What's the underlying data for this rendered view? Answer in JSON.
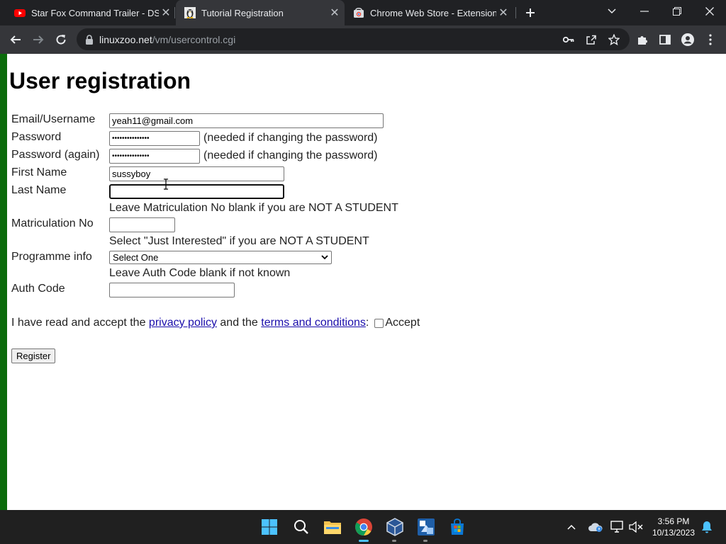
{
  "browser": {
    "tabs": [
      {
        "title": "Star Fox Command Trailer - DS -",
        "favicon": "youtube-icon",
        "active": false
      },
      {
        "title": "Tutorial Registration",
        "favicon": "tux-icon",
        "active": true
      },
      {
        "title": "Chrome Web Store - Extensions",
        "favicon": "web-store-icon",
        "active": false
      }
    ],
    "url_host": "linuxzoo.net",
    "url_path": "/vm/usercontrol.cgi"
  },
  "page": {
    "title": "User registration",
    "fields": {
      "email_label": "Email/Username",
      "email_value": "yeah11@gmail.com",
      "password_label": "Password",
      "password_value": "•••••••••••••••",
      "password_hint": "(needed if changing the password)",
      "password_again_label": "Password (again)",
      "password_again_value": "•••••••••••••••",
      "password_again_hint": "(needed if changing the password)",
      "first_name_label": "First Name",
      "first_name_value": "sussyboy",
      "last_name_label": "Last Name",
      "last_name_value": "",
      "matric_note": "Leave Matriculation No blank if you are NOT A STUDENT",
      "matric_label": "Matriculation No",
      "matric_value": "",
      "programme_note": "Select \"Just Interested\" if you are NOT A STUDENT",
      "programme_label": "Programme info",
      "programme_selected": "Select One",
      "auth_note": "Leave Auth Code blank if not known",
      "auth_label": "Auth Code",
      "auth_value": ""
    },
    "accept": {
      "prefix": "I have read and accept the",
      "privacy_link": "privacy policy",
      "middle": "and the",
      "terms_link": "terms and conditions",
      "colon": ":",
      "checkbox_label": "Accept"
    },
    "register_button": "Register"
  },
  "taskbar": {
    "time": "3:56 PM",
    "date": "10/13/2023",
    "pinned": [
      "windows-start-icon",
      "search-icon",
      "file-explorer-icon",
      "chrome-icon",
      "virtualbox-icon",
      "app-icon",
      "microsoft-store-icon"
    ]
  },
  "colors": {
    "accent_green": "#0b6b0b",
    "link": "#1a0dab",
    "chrome_dark": "#202124"
  }
}
